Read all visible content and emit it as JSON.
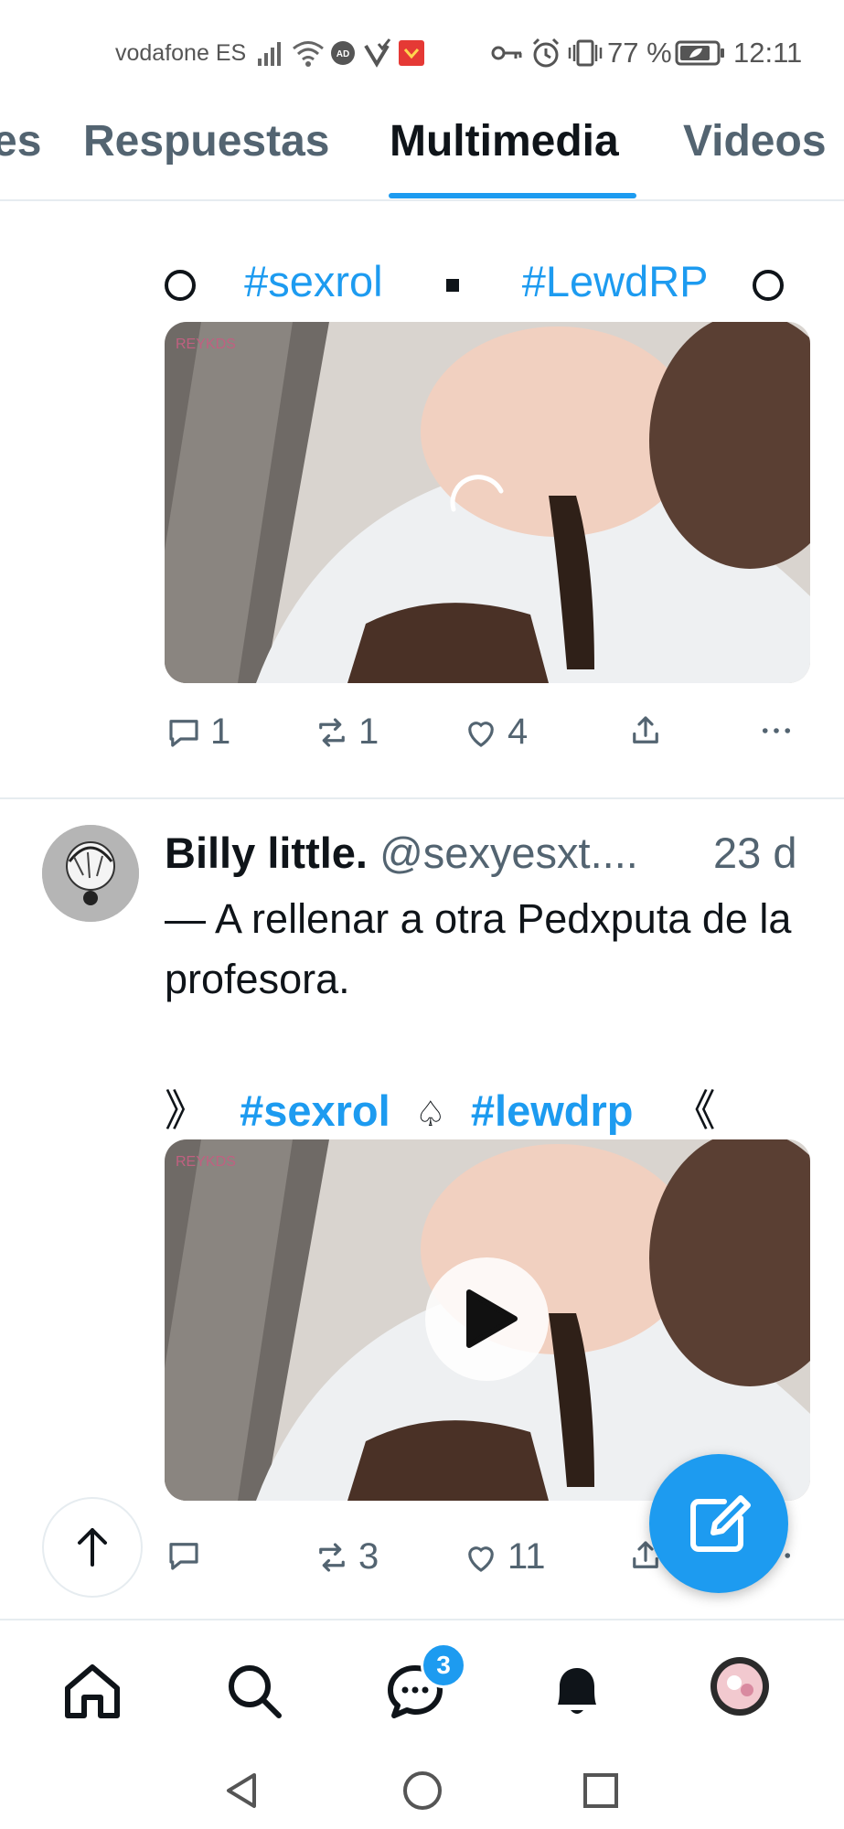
{
  "status_bar": {
    "carrier": "vodafone ES",
    "battery_percent": "77 %",
    "time": "12:11"
  },
  "tabs": {
    "partial_left": "es",
    "items": [
      "Respuestas",
      "Multimedia",
      "Videos"
    ],
    "active": "Multimedia"
  },
  "post1": {
    "hashtag_line": {
      "tag1": "#sexrol",
      "tag2": "#LewdRP"
    },
    "media_watermark": "REYKDS",
    "actions": {
      "replies": "1",
      "reposts": "1",
      "likes": "4"
    }
  },
  "post2": {
    "author_name": "Billy little.",
    "handle": "@sexyesxt....",
    "time": "23 d",
    "text": "— A rellenar a otra Pedxputa de la profesora.",
    "hashtag_line": {
      "open": "》",
      "tag1": "#sexrol",
      "separator": "♤",
      "tag2": "#lewdrp",
      "close": "《"
    },
    "media_watermark": "REYKDS",
    "actions": {
      "replies": "",
      "reposts": "3",
      "likes": "11"
    }
  },
  "bottom_nav": {
    "items": [
      "home-icon",
      "search-icon",
      "messages-icon",
      "notifications-icon",
      "profile-avatar"
    ],
    "messages_badge": "3"
  },
  "colors": {
    "accent": "#1d9bf0",
    "text": "#0f1419",
    "muted": "#536471"
  }
}
